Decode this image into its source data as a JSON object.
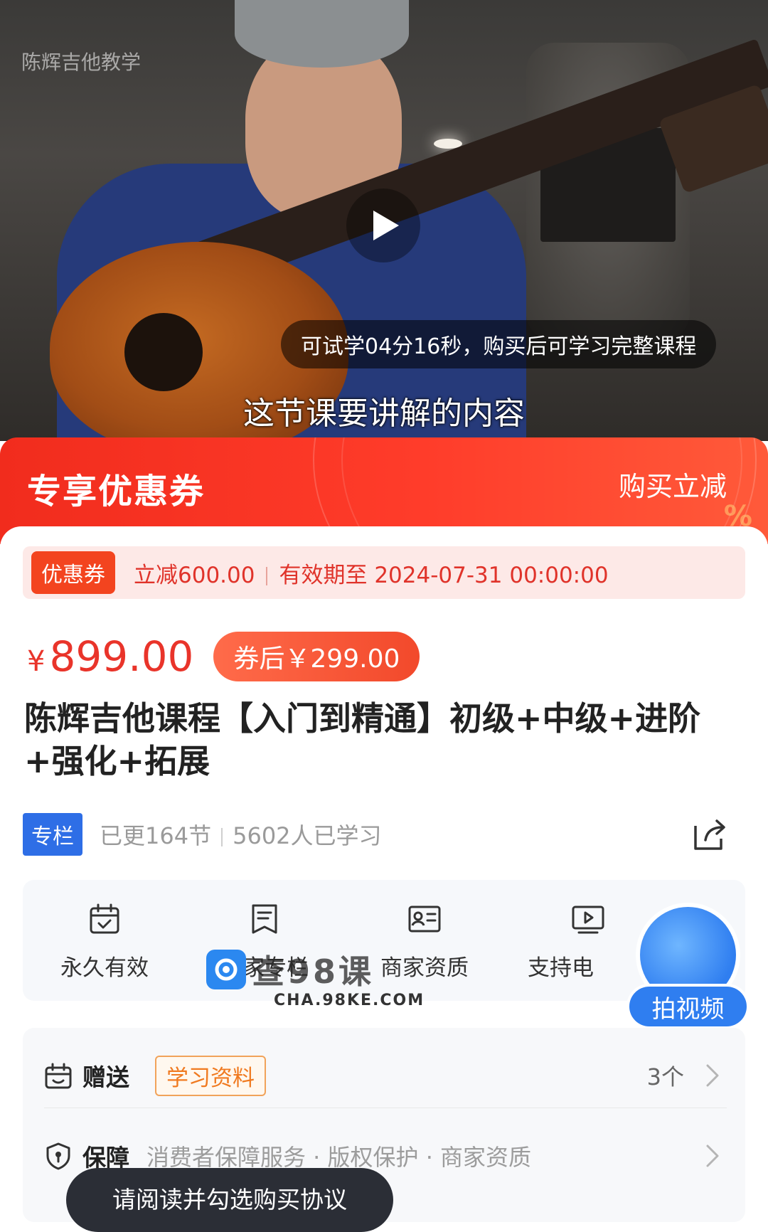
{
  "video": {
    "watermark": "陈辉吉他教学",
    "trial_tip": "可试学04分16秒，购买后可学习完整课程",
    "subtitle": "这节课要讲解的内容"
  },
  "coupon": {
    "header_title": "专享优惠券",
    "header_action": "购买立减",
    "tag": "优惠券",
    "discount": "立减600.00",
    "validity": "有效期至 2024-07-31 00:00:00"
  },
  "price": {
    "currency": "¥",
    "original": "899.00",
    "after_coupon": "券后￥299.00"
  },
  "course": {
    "title": "陈辉吉他课程【入门到精通】初级+中级+进阶+强化+拓展",
    "type_tag": "专栏",
    "updated": "已更164节",
    "learners": "5602人已学习"
  },
  "features": [
    {
      "label": "永久有效",
      "icon": "calendar-check-icon"
    },
    {
      "label": "独家专栏",
      "icon": "document-bookmark-icon"
    },
    {
      "label": "商家资质",
      "icon": "id-card-icon"
    },
    {
      "label": "支持电",
      "icon": "video-play-icon"
    }
  ],
  "watermark": {
    "logo_text": "查98课",
    "url": "CHA.98KE.COM"
  },
  "shoot_video": {
    "label": "拍视频"
  },
  "gift": {
    "label": "赠送",
    "tag": "学习资料",
    "count": "3个"
  },
  "guarantee": {
    "label": "保障",
    "items": "消费者保障服务 · 版权保护 · 商家资质"
  },
  "toast": {
    "text": "请阅读并勾选购买协议"
  },
  "colors": {
    "accent_red": "#e9342a",
    "coupon_header": "#f12c1d",
    "column_blue": "#2e6ee6",
    "gift_orange": "#f07a20"
  }
}
